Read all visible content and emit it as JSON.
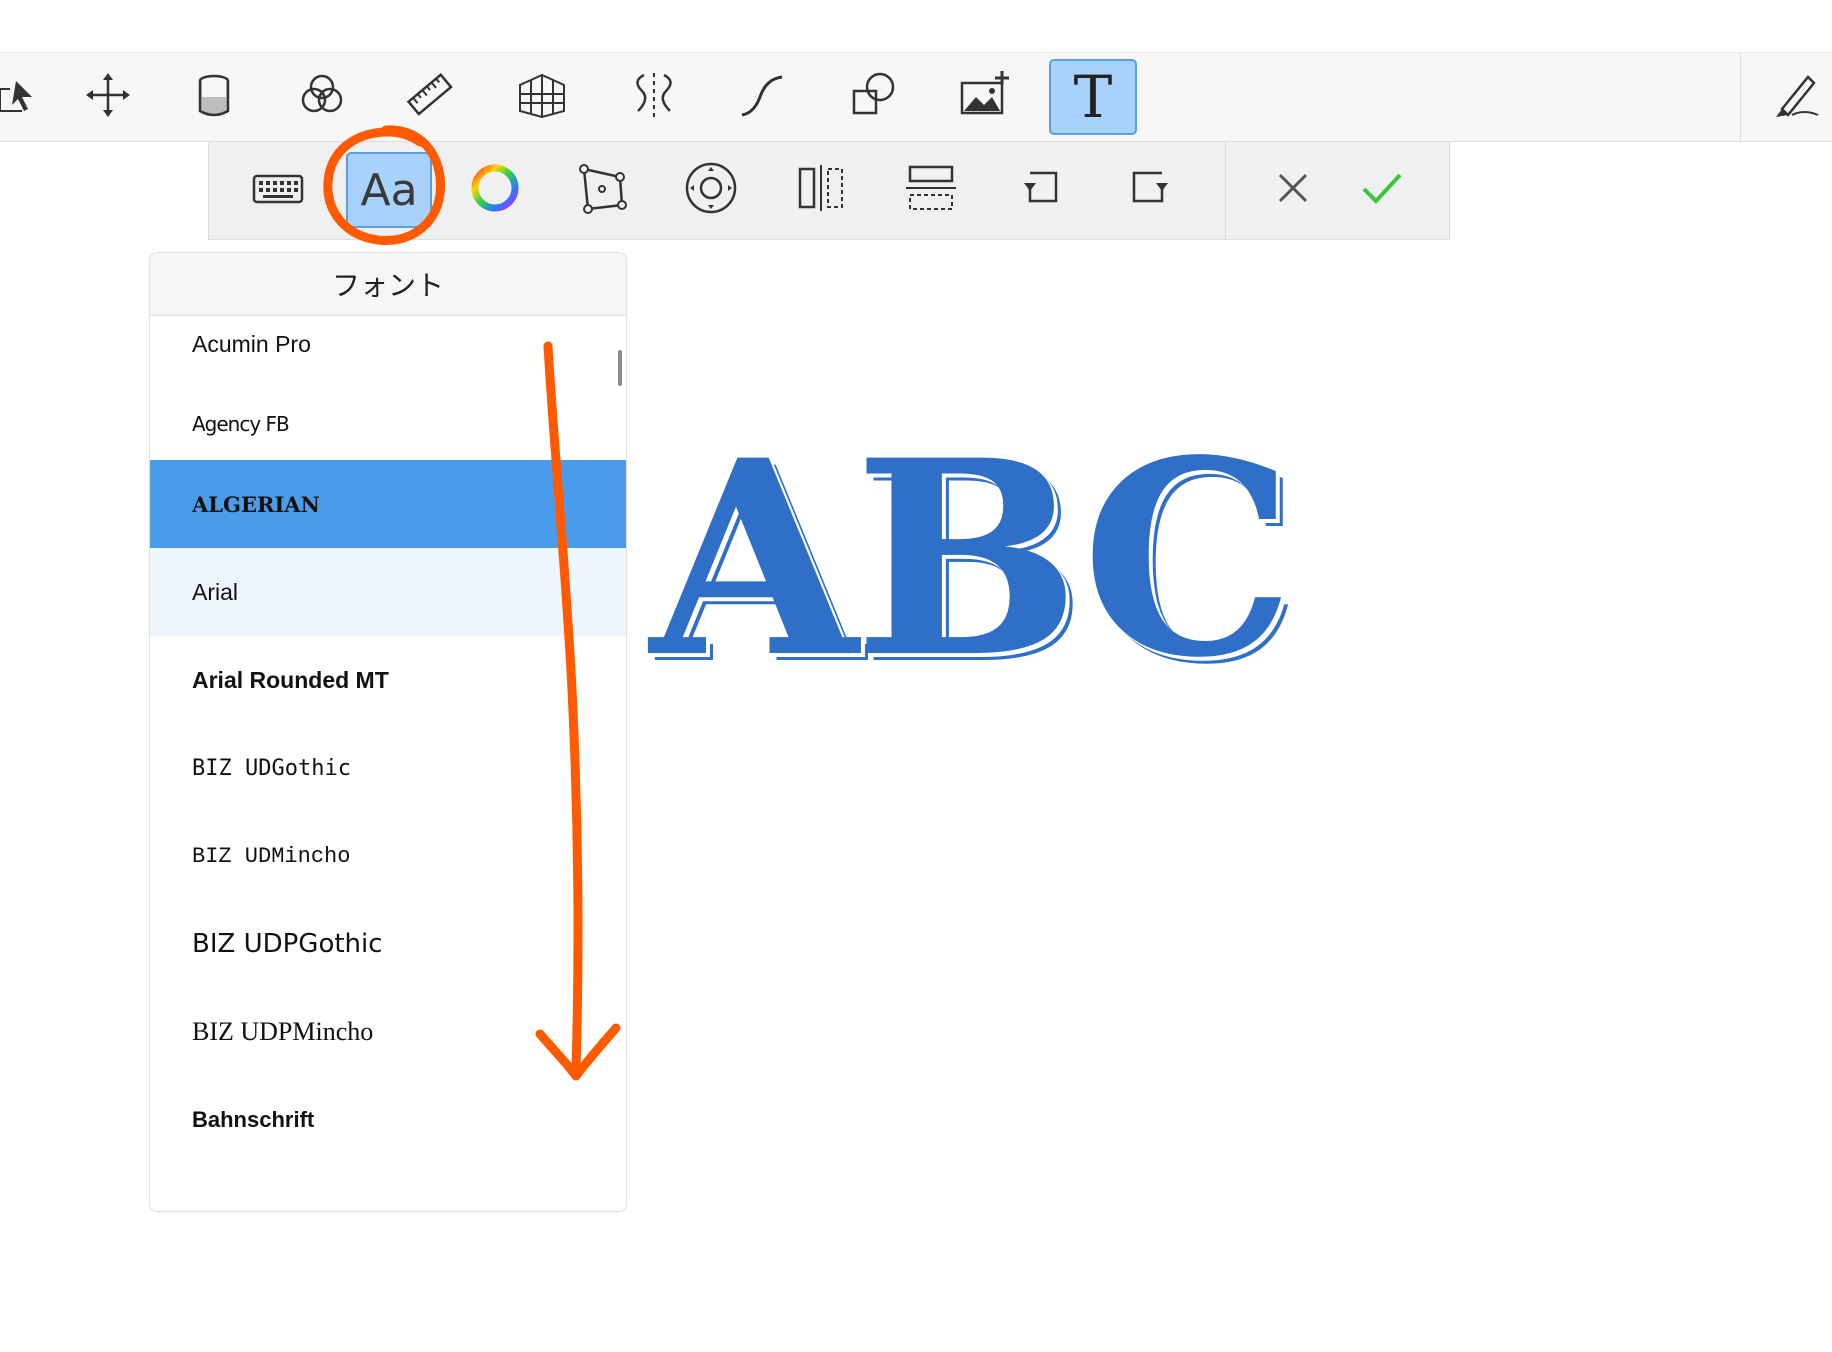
{
  "toolbar": {
    "tools": [
      {
        "name": "selection-tool",
        "icon": "selection-arrow-icon"
      },
      {
        "name": "transform-tool",
        "icon": "move-arrows-icon"
      },
      {
        "name": "fill-tool",
        "icon": "paint-bucket-icon"
      },
      {
        "name": "blend-tool",
        "icon": "overlapping-circles-icon"
      },
      {
        "name": "ruler-tool",
        "icon": "ruler-icon"
      },
      {
        "name": "perspective-tool",
        "icon": "perspective-grid-icon"
      },
      {
        "name": "symmetry-tool",
        "icon": "symmetry-icon"
      },
      {
        "name": "curve-tool",
        "icon": "curve-icon"
      },
      {
        "name": "shape-tool",
        "icon": "shapes-icon"
      },
      {
        "name": "image-import-tool",
        "icon": "add-image-icon"
      },
      {
        "name": "text-tool",
        "icon": "text-icon",
        "label": "T",
        "active": true
      }
    ],
    "right_icon": "pen-tool-icon"
  },
  "text_toolbar": {
    "items": [
      {
        "name": "keyboard-button",
        "icon": "keyboard-icon"
      },
      {
        "name": "font-button",
        "label": "Aa",
        "active": true
      },
      {
        "name": "color-button",
        "icon": "color-wheel-icon"
      },
      {
        "name": "transform-text-button",
        "icon": "distort-icon"
      },
      {
        "name": "nudge-button",
        "icon": "nudge-icon"
      },
      {
        "name": "flip-horizontal-button",
        "icon": "flip-horizontal-icon"
      },
      {
        "name": "flip-vertical-button",
        "icon": "flip-vertical-icon"
      },
      {
        "name": "rotate-left-button",
        "icon": "rotate-left-icon"
      },
      {
        "name": "rotate-right-button",
        "icon": "rotate-right-icon"
      }
    ],
    "cancel_icon": "close-icon",
    "confirm_icon": "checkmark-icon",
    "confirm_color": "#3cc43c"
  },
  "font_panel": {
    "title": "フォント",
    "fonts": [
      {
        "label": "Acumin Pro",
        "state": "normal"
      },
      {
        "label": "Agency FB",
        "state": "normal"
      },
      {
        "label": "ALGERIAN",
        "state": "selected"
      },
      {
        "label": "Arial",
        "state": "hover"
      },
      {
        "label": "Arial Rounded MT",
        "state": "normal"
      },
      {
        "label": "BIZ UDGothic",
        "state": "normal"
      },
      {
        "label": "BIZ UDMincho",
        "state": "normal"
      },
      {
        "label": "BIZ UDPGothic",
        "state": "normal"
      },
      {
        "label": "BIZ UDPMincho",
        "state": "normal"
      },
      {
        "label": "Bahnschrift",
        "state": "normal"
      }
    ]
  },
  "canvas": {
    "text": "ABC",
    "text_color": "#2f6fc7"
  },
  "annotations": {
    "color": "#ff5a00",
    "circle_target": "font-button",
    "arrow_direction": "down"
  },
  "colors": {
    "accent": "#4a9ceb",
    "active_tool_bg": "#a8d1fb",
    "hover_row_bg": "#edf5fd"
  }
}
